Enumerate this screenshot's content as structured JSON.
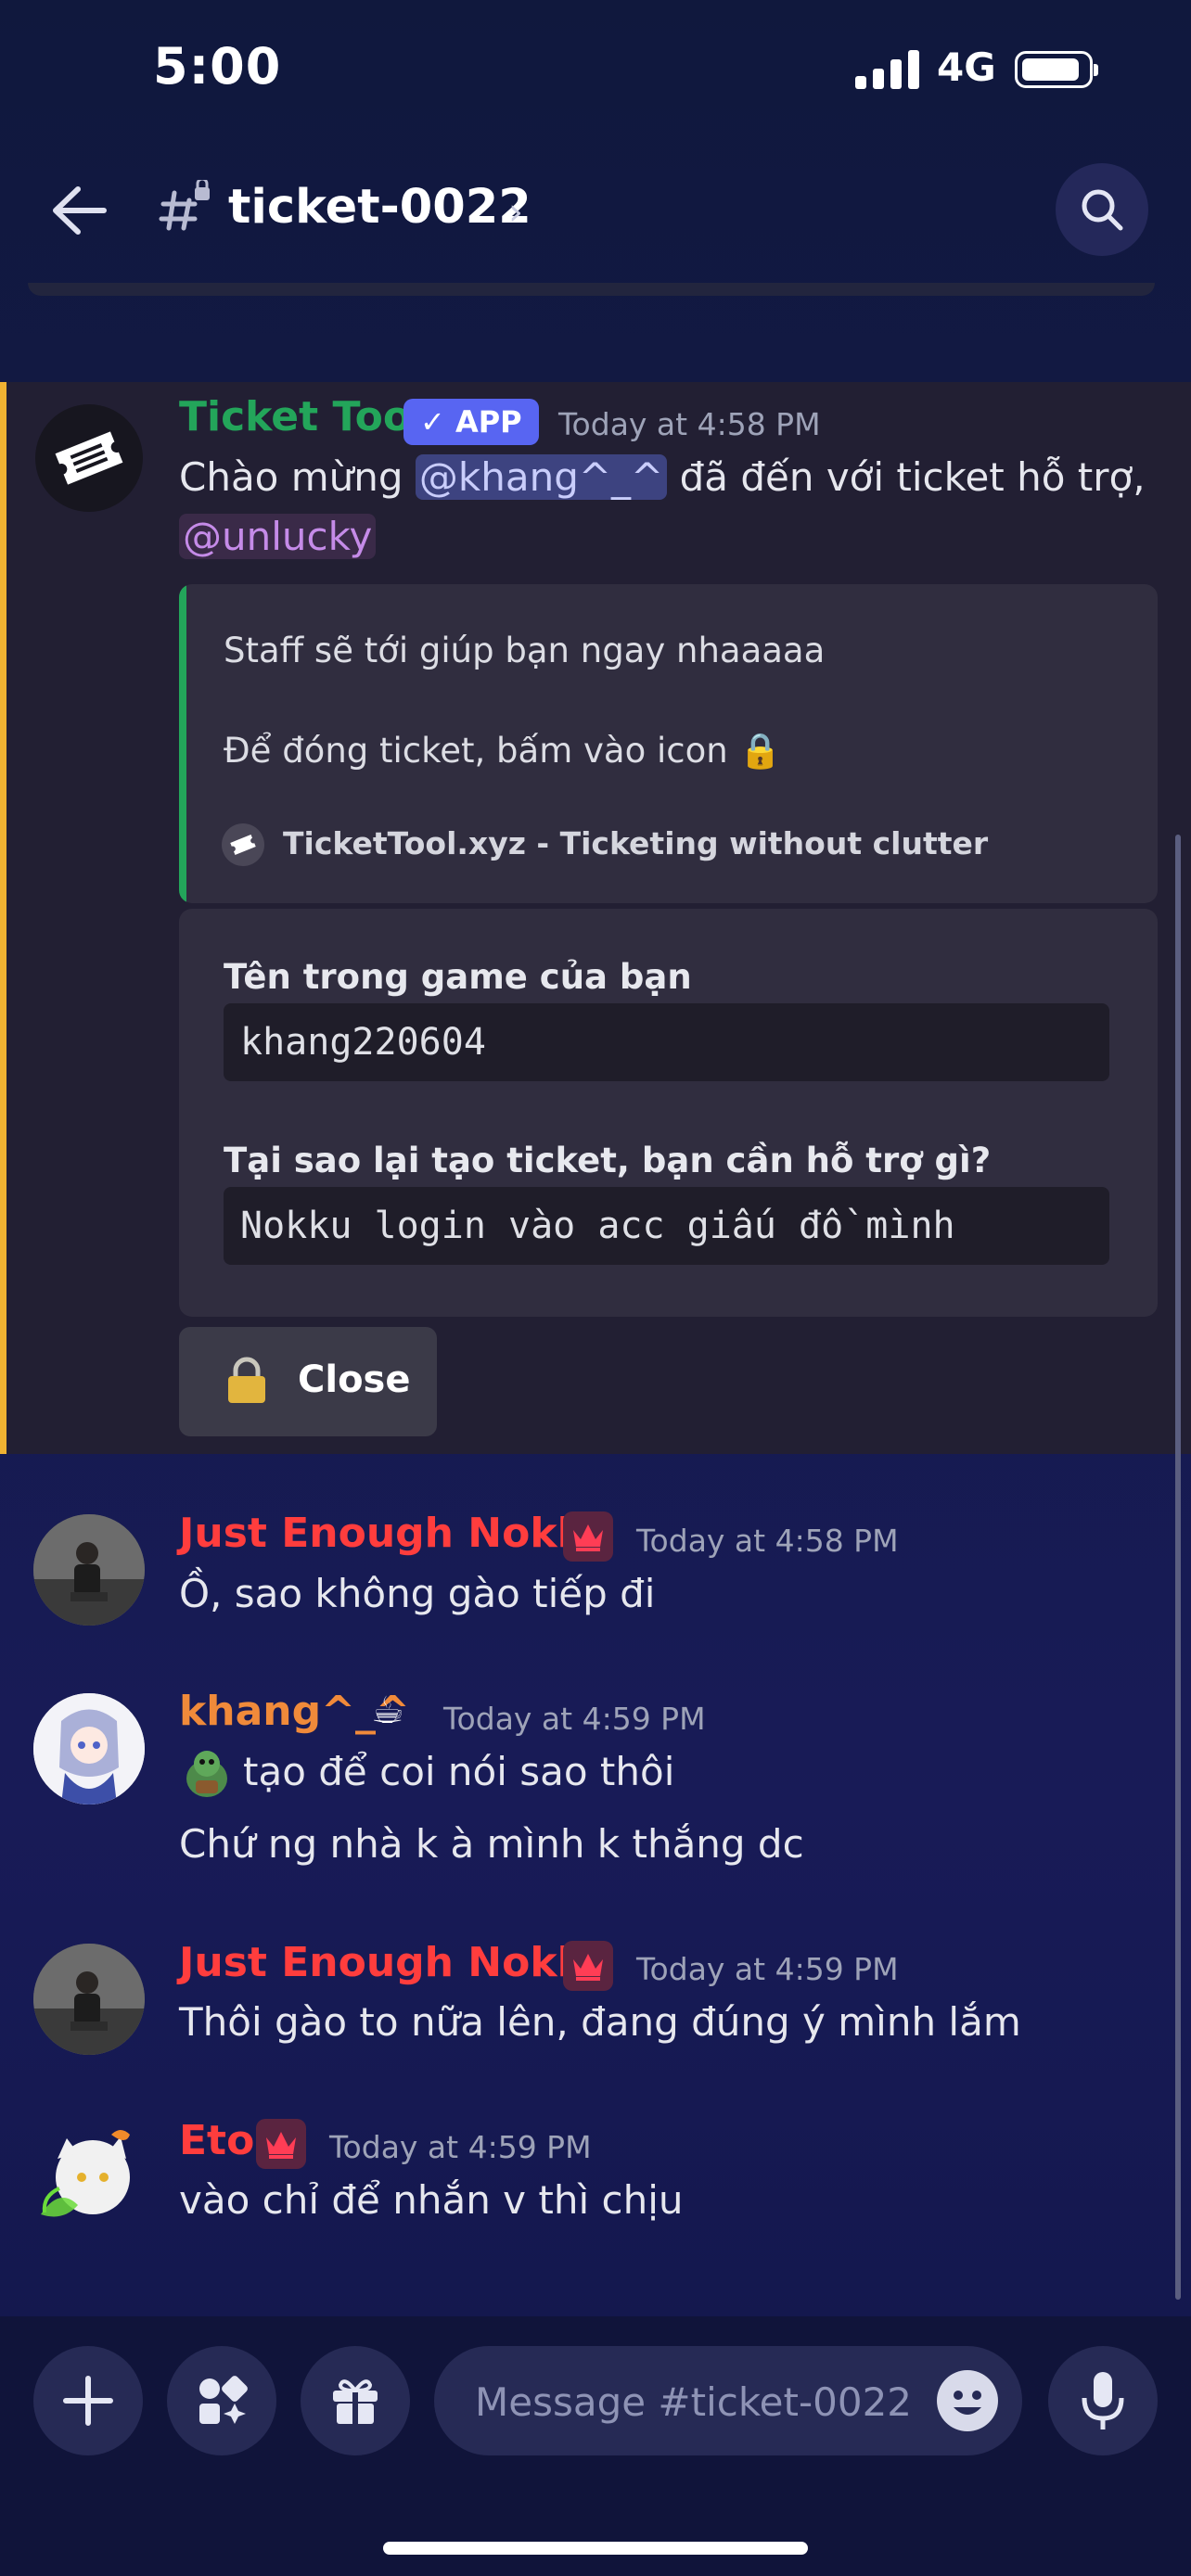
{
  "status_bar": {
    "time": "5:00",
    "network": "4G"
  },
  "header": {
    "channel_name": "ticket-0022",
    "chevron": "›"
  },
  "bot_message": {
    "author": "Ticket Tool",
    "badge": "✓ APP",
    "timestamp": "Today at 4:58 PM",
    "text_prefix": "Chào mừng ",
    "mention_user": "@khang^_^",
    "text_suffix": " đã đến với ticket hỗ trợ,",
    "mention_role": "@unlucky",
    "embed": {
      "line1": "Staff sẽ tới giúp bạn ngay nhaaaaa",
      "line2": "Để đóng ticket, bấm vào icon 🔒",
      "footer": "TicketTool.xyz - Ticketing without clutter"
    },
    "form": {
      "q1": "Tên trong game của bạn",
      "a1": "khang220604",
      "q2": "Tại sao lại tạo ticket, bạn cần hỗ trợ gì?",
      "a2": "Nokku login vào acc giấu đồ mình"
    },
    "close_button": "Close"
  },
  "messages": [
    {
      "author": "Just Enough Nokku",
      "timestamp": "Today at 4:58 PM",
      "lines": [
        "Ồ, sao không gào tiếp đi"
      ]
    },
    {
      "author": "khang^_^",
      "author_emoji": "☕",
      "timestamp": "Today at 4:59 PM",
      "lines": [
        "tạo để coi nói sao thôi",
        "Chứ ng nhà k à mình k thắng dc"
      ]
    },
    {
      "author": "Just Enough Nokku",
      "timestamp": "Today at 4:59 PM",
      "lines": [
        "Thôi gào to nữa lên, đang đúng ý mình lắm"
      ]
    },
    {
      "author": "Eto",
      "timestamp": "Today at 4:59 PM",
      "lines": [
        "vào chỉ để nhắn v thì chịu"
      ]
    }
  ],
  "composer": {
    "placeholder": "Message #ticket-0022"
  },
  "colors": {
    "accent": "#5865f2",
    "owner_red": "#ff3d3d",
    "khang_orange": "#f08a3a",
    "bot_green": "#23a55a",
    "highlight_bar": "#f0b232"
  }
}
